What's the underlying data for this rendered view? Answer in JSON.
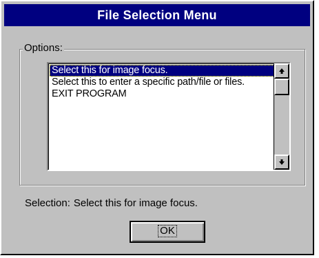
{
  "window": {
    "title": "File Selection Menu"
  },
  "options_group": {
    "label": "Options:"
  },
  "listbox": {
    "items": [
      {
        "label": "Select this for image focus.",
        "selected": true
      },
      {
        "label": "Select this to enter a specific path/file or files.",
        "selected": false
      },
      {
        "label": "EXIT PROGRAM",
        "selected": false
      }
    ],
    "scrollbar": {
      "up_icon": "arrow-up-icon",
      "down_icon": "arrow-down-icon"
    }
  },
  "selection": {
    "label": "Selection:",
    "value": "Select this for image focus."
  },
  "ok_button": {
    "label": "OK"
  },
  "colors": {
    "face": "#c0c0c0",
    "titlebar": "#000080",
    "highlight": "#000080",
    "highlight_text": "#ffffff"
  }
}
